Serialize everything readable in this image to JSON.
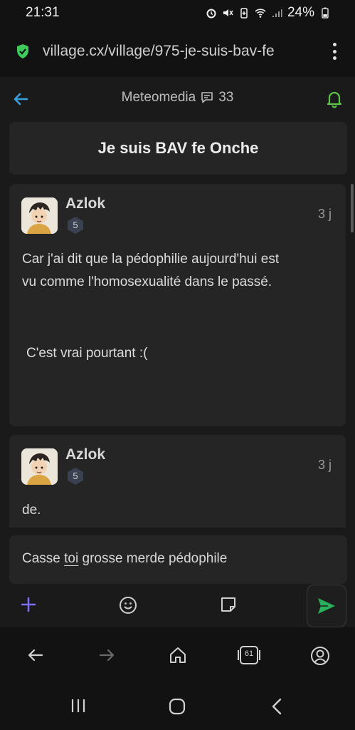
{
  "status": {
    "time": "21:31",
    "battery": "24%"
  },
  "browser": {
    "url": "village.cx/village/975-je-suis-bav-fe"
  },
  "header": {
    "forum": "Meteomedia",
    "comment_count": "33"
  },
  "thread": {
    "title": "Je suis BAV fe Onche"
  },
  "posts": [
    {
      "author": "Azlok",
      "level": "5",
      "time_ago": "3 j",
      "lines": [
        "Car j'ai dit que la pédophilie aujourd'hui est",
        "vu comme l'homosexualité dans le passé.",
        "C'est vrai pourtant :("
      ]
    },
    {
      "author": "Azlok",
      "level": "5",
      "time_ago": "3 j",
      "lines": [
        "de."
      ]
    }
  ],
  "composer": {
    "before": "Casse ",
    "underlined": "toi",
    "after": " grosse merde pédophile"
  },
  "bottom_nav": {
    "tab_count": "61"
  },
  "colors": {
    "accent_blue": "#3a9fd8",
    "bell_green": "#5cc44a",
    "send_green": "#26b15a",
    "plus_purple": "#7c6cf0",
    "shield_green": "#3ecb5a"
  }
}
